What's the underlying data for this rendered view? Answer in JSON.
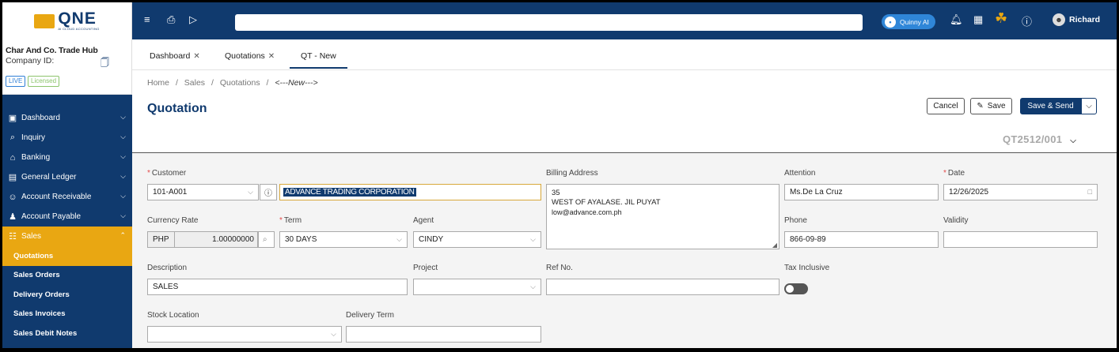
{
  "brand": {
    "logo_text": "QNE",
    "logo_sub": "AI CLOUD ACCOUNTING"
  },
  "company": {
    "name": "Char And Co. Trade Hub",
    "id_label": "Company ID:",
    "badge_live": "LIVE",
    "badge_licensed": "Licensed"
  },
  "nav": {
    "items": [
      {
        "label": "Dashboard",
        "icon": "dashboard-icon"
      },
      {
        "label": "Inquiry",
        "icon": "inquiry-icon"
      },
      {
        "label": "Banking",
        "icon": "bank-icon"
      },
      {
        "label": "General Ledger",
        "icon": "ledger-icon"
      },
      {
        "label": "Account Receivable",
        "icon": "receivable-icon"
      },
      {
        "label": "Account Payable",
        "icon": "payable-icon"
      },
      {
        "label": "Sales",
        "icon": "sales-icon"
      }
    ],
    "sales_sub": [
      "Quotations",
      "Sales Orders",
      "Delivery Orders",
      "Sales Invoices",
      "Sales Debit Notes"
    ]
  },
  "topbar": {
    "assistant": "Quinny AI",
    "user": "Richard"
  },
  "tabs": [
    "Dashboard",
    "Quotations",
    "QT - New"
  ],
  "breadcrumb": {
    "home": "Home",
    "sales": "Sales",
    "quotations": "Quotations",
    "current": "<---New--->",
    "sep": "/"
  },
  "page": {
    "title": "Quotation",
    "doc_no": "QT2512/001"
  },
  "actions": {
    "cancel": "Cancel",
    "save": "Save",
    "save_send": "Save & Send"
  },
  "form": {
    "customer_label": "Customer",
    "customer_code": "101-A001",
    "customer_name": "ADVANCE TRADING CORPORATION",
    "billing_label": "Billing Address",
    "billing_line1": "35",
    "billing_line2": "WEST OF AYALASE. JIL PUYAT",
    "billing_line3": "low@advance.com.ph",
    "attention_label": "Attention",
    "attention": "Ms.De La Cruz",
    "date_label": "Date",
    "date": "12/26/2025",
    "currency_label": "Currency Rate",
    "currency": "PHP",
    "rate": "1.00000000",
    "term_label": "Term",
    "term": "30 DAYS",
    "agent_label": "Agent",
    "agent": "CINDY",
    "phone_label": "Phone",
    "phone": "866-09-89",
    "validity_label": "Validity",
    "validity": "",
    "description_label": "Description",
    "description": "SALES",
    "project_label": "Project",
    "project": "",
    "ref_label": "Ref No.",
    "ref": "",
    "tax_label": "Tax Inclusive",
    "stock_label": "Stock Location",
    "stock": "",
    "delivery_label": "Delivery Term",
    "delivery": ""
  }
}
